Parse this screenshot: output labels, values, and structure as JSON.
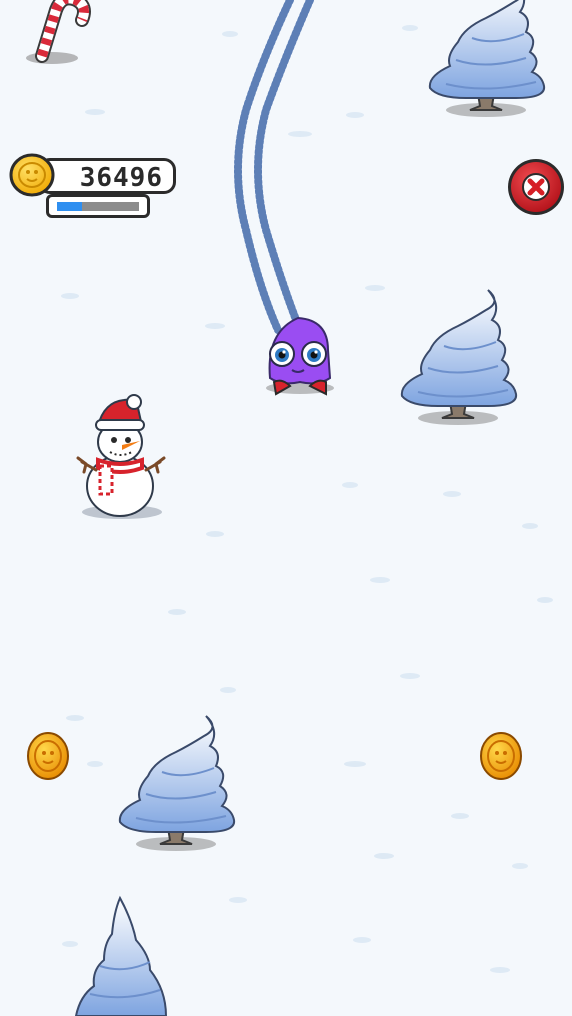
{
  "hud": {
    "coins": "36496",
    "progress_fraction": 0.3
  },
  "icons": {
    "coin": "coin-icon",
    "close": "close-icon"
  },
  "colors": {
    "snow": "#f4f8fc",
    "tree_blue": "#7ea4e0",
    "character_purple": "#9a4df2",
    "close_red": "#d61f26",
    "progress_blue": "#2f8ff0",
    "coin_gold": "#f5b800",
    "ski_track": "#5d7fb6"
  }
}
